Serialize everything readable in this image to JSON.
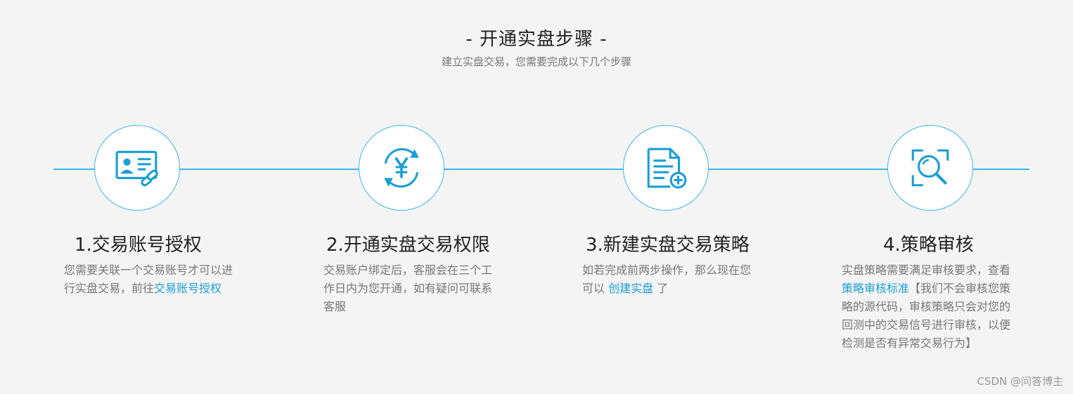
{
  "header": {
    "title": "- 开通实盘步骤 -",
    "subtitle": "建立实盘交易，您需要完成以下几个步骤"
  },
  "colors": {
    "accent": "#3fb6e8",
    "link": "#1a9fd6",
    "icon": "#1a9fd6"
  },
  "steps": [
    {
      "icon": "id-card-link-icon",
      "title": "1.交易账号授权",
      "desc_pre": "您需要关联一个交易账号才可以进行实盘交易，前往",
      "desc_link": "交易账号授权",
      "desc_post": ""
    },
    {
      "icon": "yen-refresh-icon",
      "title": "2.开通实盘交易权限",
      "desc_pre": "交易账户绑定后，客服会在三个工作日内为您开通，如有疑问可联系客服",
      "desc_link": "",
      "desc_post": ""
    },
    {
      "icon": "document-add-icon",
      "title": "3.新建实盘交易策略",
      "desc_pre": "如若完成前两步操作，那么现在您可以 ",
      "desc_link": "创建实盘",
      "desc_post": " 了"
    },
    {
      "icon": "search-review-icon",
      "title": "4.策略审核",
      "desc_pre": "实盘策略需要满足审核要求，查看",
      "desc_link": "策略审核标准",
      "desc_post": "【我们不会审核您策略的源代码，审核策略只会对您的回测中的交易信号进行审核，以便检测是否有异常交易行为】"
    }
  ],
  "watermark": "CSDN @问答博主"
}
